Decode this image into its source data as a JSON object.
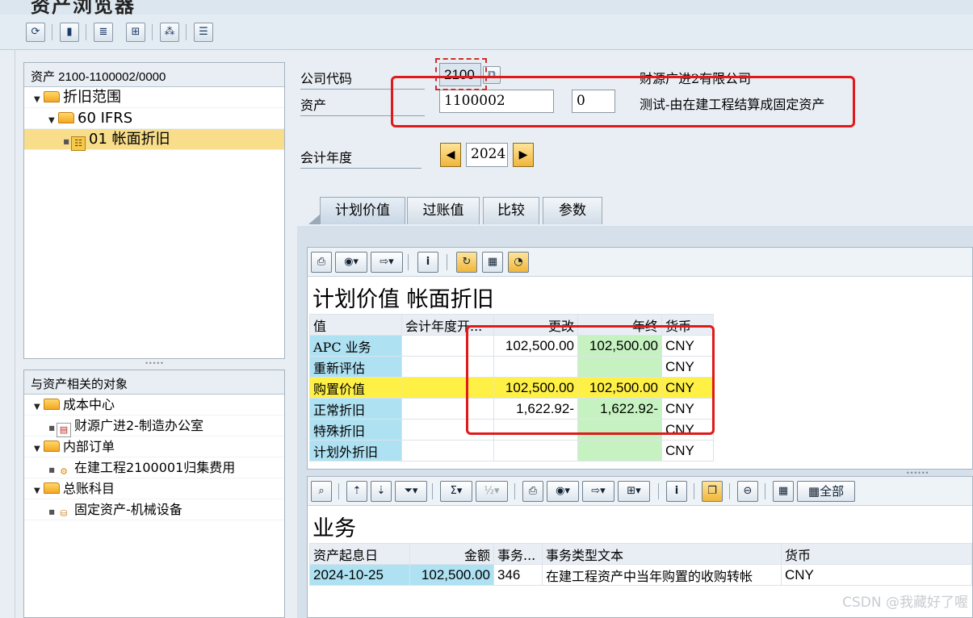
{
  "window": {
    "title": "资产浏览器"
  },
  "toolbar": {
    "icons": [
      "refresh-icon",
      "save-icon",
      "multi-select-icon",
      "export-icon",
      "hierarchy-icon",
      "list-icon"
    ]
  },
  "left": {
    "tree_header": "资产 2100-1100002/0000",
    "tree": [
      {
        "label": "折旧范围"
      },
      {
        "label": "60  IFRS"
      },
      {
        "label": "01  帐面折旧"
      }
    ],
    "related_header": "与资产相关的对象",
    "related": [
      {
        "label": "成本中心"
      },
      {
        "label": "财源广进2-制造办公室"
      },
      {
        "label": "内部订单"
      },
      {
        "label": "在建工程2100001归集费用"
      },
      {
        "label": "总账科目"
      },
      {
        "label": "固定资产-机械设备"
      }
    ]
  },
  "header": {
    "company_code_label": "公司代码",
    "company_code_value": "2100",
    "company_name": "财源广进2有限公司",
    "asset_label": "资产",
    "asset_value": "1100002",
    "sub_number_value": "0",
    "asset_desc": "测试-由在建工程结算成固定资产",
    "fiscal_year_label": "会计年度",
    "fiscal_year_value": "2024"
  },
  "tabs": [
    "计划价值",
    "过账值",
    "比较",
    "参数"
  ],
  "planned_values": {
    "title": "计划价值 帐面折旧",
    "columns": [
      "值",
      "会计年度开...",
      "更改",
      "年终",
      "货币"
    ],
    "rows": [
      {
        "label": "APC 业务",
        "start": "",
        "change": "102,500.00",
        "end": "102,500.00",
        "currency": "CNY"
      },
      {
        "label": "重新评估",
        "start": "",
        "change": "",
        "end": "",
        "currency": "CNY"
      },
      {
        "label": "购置价值",
        "start": "",
        "change": "102,500.00",
        "end": "102,500.00",
        "currency": "CNY"
      },
      {
        "label": "正常折旧",
        "start": "",
        "change": "1,622.92-",
        "end": "1,622.92-",
        "currency": "CNY"
      },
      {
        "label": "特殊折旧",
        "start": "",
        "change": "",
        "end": "",
        "currency": "CNY"
      },
      {
        "label": "计划外折旧",
        "start": "",
        "change": "",
        "end": "",
        "currency": "CNY"
      }
    ]
  },
  "transactions": {
    "title": "业务",
    "all_button": "全部",
    "columns": [
      "资产起息日",
      "金额",
      "事务...",
      "事务类型文本",
      "货币"
    ],
    "rows": [
      {
        "date": "2024-10-25",
        "amount": "102,500.00",
        "type": "346",
        "text": "在建工程资产中当年购置的收购转帐",
        "currency": "CNY"
      }
    ]
  },
  "watermark": "CSDN @我藏好了喔",
  "colors": {
    "highlight_yellow": "#fff046",
    "key_blue": "#aee1f2",
    "total_green": "#c6f1c0",
    "annotation_red": "#e01a1a"
  }
}
